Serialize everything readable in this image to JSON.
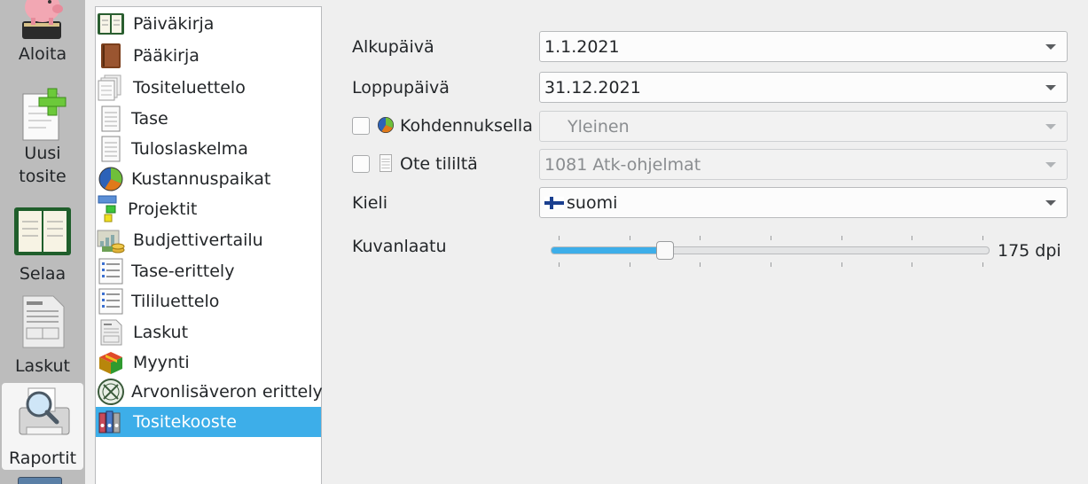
{
  "nav": {
    "items": [
      {
        "label": "Aloita",
        "icon": "piggy-bank-icon"
      },
      {
        "label": "Uusi\ntosite",
        "icon": "new-document-plus-icon"
      },
      {
        "label": "Selaa",
        "icon": "ledger-book-icon"
      },
      {
        "label": "Laskut",
        "icon": "invoice-icon"
      },
      {
        "label": "Raportit",
        "icon": "report-magnifier-icon"
      }
    ],
    "active": "Raportit"
  },
  "reports": {
    "items": [
      {
        "label": "Päiväkirja",
        "icon": "journal-icon"
      },
      {
        "label": "Pääkirja",
        "icon": "brown-book-icon"
      },
      {
        "label": "Tositeluettelo",
        "icon": "document-stack-icon"
      },
      {
        "label": "Tase",
        "icon": "page-icon"
      },
      {
        "label": "Tuloslaskelma",
        "icon": "page-icon"
      },
      {
        "label": "Kustannuspaikat",
        "icon": "pie-chart-icon"
      },
      {
        "label": "Projektit",
        "icon": "project-blocks-icon"
      },
      {
        "label": "Budjettivertailu",
        "icon": "budget-icon"
      },
      {
        "label": "Tase-erittely",
        "icon": "list-page-icon"
      },
      {
        "label": "Tililuettelo",
        "icon": "list-page-icon"
      },
      {
        "label": "Laskut",
        "icon": "invoice-page-icon"
      },
      {
        "label": "Myynti",
        "icon": "box-icon"
      },
      {
        "label": "Arvonlisäveron erittely",
        "icon": "vat-stamp-icon"
      },
      {
        "label": "Tositekooste",
        "icon": "binders-icon"
      }
    ],
    "selected": "Tositekooste"
  },
  "form": {
    "start_label": "Alkupäivä",
    "start_value": "1.1.2021",
    "end_label": "Loppupäivä",
    "end_value": "31.12.2021",
    "cost_center_label": "Kohdennuksella",
    "cost_center_value": "Yleinen",
    "account_label": "Ote tililtä",
    "account_value": "1081 Atk-ohjelmat",
    "language_label": "Kieli",
    "language_value": "suomi",
    "quality_label": "Kuvanlaatu",
    "quality_value_text": "175 dpi",
    "quality_fraction": 0.26
  },
  "colors": {
    "accent": "#3daee9",
    "nav_background": "#bcbcbc",
    "window_background": "#efefef"
  }
}
